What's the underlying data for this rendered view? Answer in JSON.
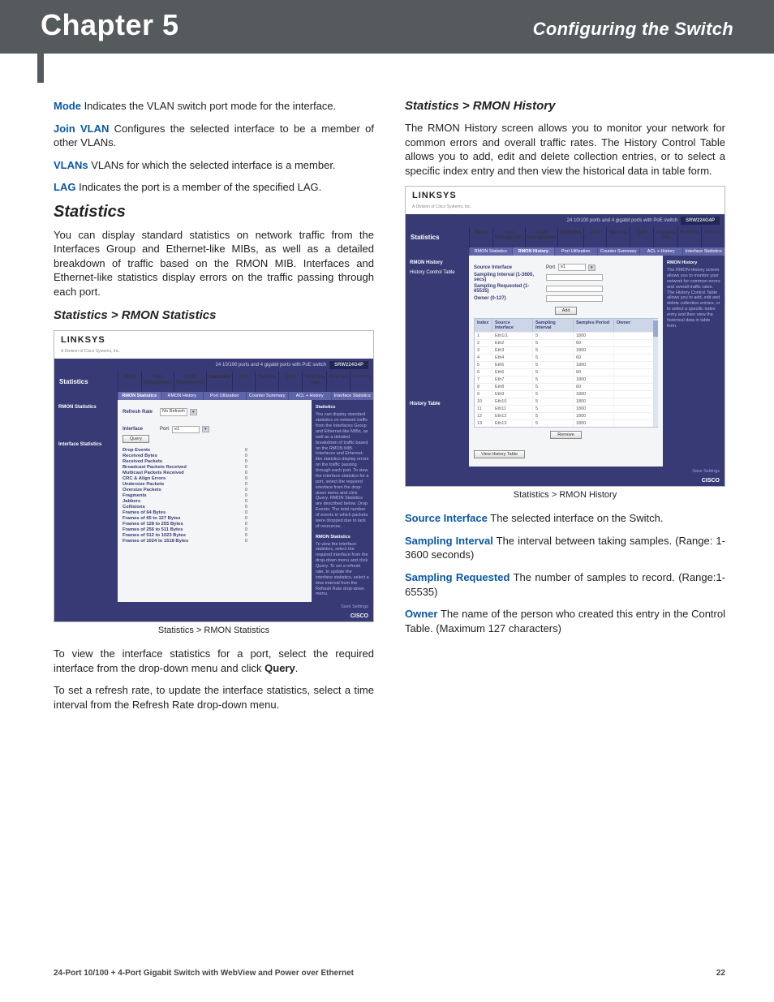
{
  "header": {
    "chapter": "Chapter 5",
    "section": "Configuring the Switch"
  },
  "left_col": {
    "defs": [
      {
        "term": "Mode",
        "text": " Indicates the VLAN switch port mode for the interface."
      },
      {
        "term": "Join VLAN",
        "text": " Configures the selected interface to be a member of other VLANs."
      },
      {
        "term": "VLANs",
        "text": " VLANs for which the selected interface is a member."
      },
      {
        "term": "LAG",
        "text": " Indicates the port is a member of the specified LAG."
      }
    ],
    "h2": "Statistics",
    "p1": "You can display standard statistics on network traffic from the Interfaces Group and Ethernet-like MIBs, as well as a detailed breakdown of traffic based on the RMON MIB. Interfaces and Ethernet-like statistics display errors on the traffic passing through each port.",
    "h3": "Statistics > RMON Statistics",
    "caption": "Statistics > RMON Statistics",
    "p2a": "To view the interface statistics for a port, select the required interface from the drop-down menu and click ",
    "p2b": "Query",
    "p2c": ".",
    "p3": "To set a refresh rate, to update the interface statistics, select a time interval from the Refresh Rate drop-down menu."
  },
  "right_col": {
    "h3": "Statistics > RMON History",
    "p1": "The RMON History screen allows you to monitor your network for common errors and overall traffic rates. The History Control Table allows you to add, edit and delete collection entries, or to select a specific index entry and then view the historical data in table form.",
    "caption": "Statistics > RMON History",
    "defs": [
      {
        "term": "Source Interface",
        "text": " The selected interface on the Switch."
      },
      {
        "term": "Sampling Interval",
        "text": " The interval between taking samples. (Range: 1-3600 seconds)"
      },
      {
        "term": "Sampling Requested",
        "text": " The number of samples to record. (Range:1-65535)"
      },
      {
        "term": "Owner",
        "text": " The name of the person who created this entry in the Control Table. (Maximum 127 characters)"
      }
    ]
  },
  "screenshot_common": {
    "brand": "LINKSYS",
    "tagline": "A Division of Cisco Systems, Inc.",
    "product_desc": "24 10/100 ports and 4 gigabit ports with PoE switch",
    "model": "SRW224G4P",
    "bigtab": "Statistics",
    "tabs": [
      "Setup",
      "Port Management",
      "VLAN Management",
      "Statistics",
      "ACL",
      "Security",
      "QoS",
      "Spanning Tree",
      "Multicast",
      "More >>"
    ],
    "foot_save": "Save Settings",
    "foot_logo": "CISCO"
  },
  "shot1": {
    "subtabs": [
      "RMON Statistics",
      "RMON History",
      "Port Utilization",
      "Counter Summary",
      "ACL + History",
      "Interface Statistics"
    ],
    "side": [
      "RMON Statistics",
      "",
      "Interface Statistics"
    ],
    "refresh_label": "Refresh Rate",
    "refresh_value": "No Refresh",
    "iface_label": "Interface",
    "iface_radio": "Port",
    "iface_value": "e1",
    "query": "Query",
    "rows": [
      [
        "Drop Events",
        "0"
      ],
      [
        "Received Bytes",
        "0"
      ],
      [
        "Received Packets",
        "0"
      ],
      [
        "Broadcast Packets Received",
        "0"
      ],
      [
        "Multicast Packets Received",
        "0"
      ],
      [
        "CRC & Align Errors",
        "0"
      ],
      [
        "Undersize Packets",
        "0"
      ],
      [
        "Oversize Packets",
        "0"
      ],
      [
        "Fragments",
        "0"
      ],
      [
        "Jabbers",
        "0"
      ],
      [
        "Collisions",
        "0"
      ],
      [
        "Frames of 64 Bytes",
        "0"
      ],
      [
        "Frames of 65 to 127 Bytes",
        "0"
      ],
      [
        "Frames of 128 to 255 Bytes",
        "0"
      ],
      [
        "Frames of 256 to 511 Bytes",
        "0"
      ],
      [
        "Frames of 512 to 1023 Bytes",
        "0"
      ],
      [
        "Frames of 1024 to 1518 Bytes",
        "0"
      ]
    ],
    "help_title": "Statistics",
    "help_body": "You can display standard statistics on network traffic from the Interfaces Group and Ethernet-like MIBs, as well as a detailed breakdown of traffic based on the RMON MIB. Interfaces and Ethernet-like statistics display errors on the traffic passing through each port. To view the interface statistics for a port, select the required interface from the drop-down menu and click Query. RMON Statistics are described below. Drop Events. The total number of events in which packets were dropped due to lack of resources.",
    "help_title2": "RMON Statistics",
    "help_body2": "To view the interface statistics, select the required interface from the drop-down menu and click Query. To set a refresh rate, to update the interface statistics, select a time interval from the Refresh Rate drop-down menu."
  },
  "shot2": {
    "subtabs": [
      "RMON Statistics",
      "RMON History",
      "Port Utilization",
      "Counter Summary",
      "ACL + History",
      "Interface Statistics"
    ],
    "side": [
      "RMON History",
      "History Control Table",
      "",
      "",
      "",
      "",
      "",
      "",
      "",
      "History Table"
    ],
    "src_label": "Source Interface",
    "port_label": "Port",
    "port_value": "e1",
    "samp_int_label": "Sampling Interval (1-3600, secs)",
    "samp_req_label": "Sampling Requested (1-65535)",
    "owner_label": "Owner (0-127)",
    "add_btn": "Add",
    "thead": [
      "Index",
      "Source Interface",
      "Sampling Interval",
      "Samples Period",
      "Owner"
    ],
    "trows": [
      [
        "1",
        "Eth1/1",
        "5",
        "1800",
        ""
      ],
      [
        "2",
        "Eth2",
        "5",
        "60",
        ""
      ],
      [
        "3",
        "Eth3",
        "5",
        "1800",
        ""
      ],
      [
        "4",
        "Eth4",
        "5",
        "60",
        ""
      ],
      [
        "5",
        "Eth5",
        "5",
        "1800",
        ""
      ],
      [
        "6",
        "Eth6",
        "5",
        "60",
        ""
      ],
      [
        "7",
        "Eth7",
        "5",
        "1800",
        ""
      ],
      [
        "8",
        "Eth8",
        "5",
        "60",
        ""
      ],
      [
        "9",
        "Eth9",
        "5",
        "1800",
        ""
      ],
      [
        "10",
        "Eth10",
        "5",
        "1800",
        ""
      ],
      [
        "11",
        "Eth11",
        "5",
        "1800",
        ""
      ],
      [
        "12",
        "Eth12",
        "5",
        "1800",
        ""
      ],
      [
        "13",
        "Eth13",
        "5",
        "1800",
        ""
      ]
    ],
    "remove_btn": "Remove",
    "view_btn": "View History Table",
    "help_title": "RMON History",
    "help_body": "The RMON History screen allows you to monitor your network for common errors and overall traffic rates. The History Control Table allows you to add, edit and delete collection entries, or to select a specific index entry and then view the historical data in table form."
  },
  "footer": {
    "left": "24-Port 10/100 + 4-Port Gigabit Switch with WebView and Power over Ethernet",
    "right": "22"
  }
}
